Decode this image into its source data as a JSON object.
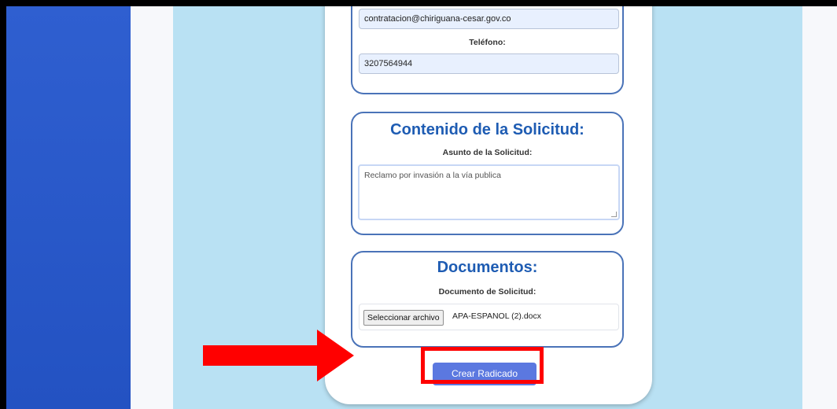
{
  "contact": {
    "email_value": "contratacion@chiriguana-cesar.gov.co",
    "phone_label": "Teléfono:",
    "phone_value": "3207564944"
  },
  "content": {
    "title": "Contenido de la Solicitud:",
    "subject_label": "Asunto de la Solicitud:",
    "subject_value": "Reclamo por invasión a la vía publica"
  },
  "documents": {
    "title": "Documentos:",
    "doc_label": "Documento de Solicitud:",
    "file_button": "Seleccionar archivo",
    "file_name": "APA-ESPANOL (2).docx"
  },
  "actions": {
    "submit_label": "Crear Radicado"
  },
  "colors": {
    "highlight": "#ff0000",
    "arrow": "#ff0000",
    "accent": "#1e5cb3",
    "button": "#5b78e0"
  }
}
